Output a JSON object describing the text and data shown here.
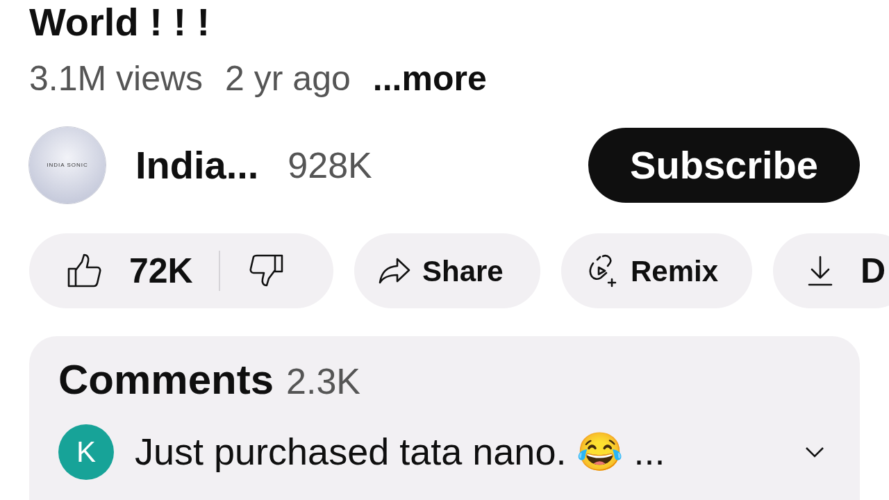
{
  "title": "World ! ! !",
  "meta": {
    "views": "3.1M views",
    "age": "2 yr ago",
    "more": "...more"
  },
  "channel": {
    "name": "India...",
    "avatar_text": "INDIA SONIC",
    "subscribers": "928K",
    "subscribe": "Subscribe"
  },
  "actions": [
    {
      "kind": "like",
      "label": "72K"
    },
    {
      "kind": "share",
      "label": "Share"
    },
    {
      "kind": "remix",
      "label": "Remix"
    },
    {
      "kind": "download",
      "label": "D"
    }
  ],
  "comments": {
    "title": "Comments",
    "count": "2.3K",
    "top": {
      "avatar": "K",
      "text": "Just purchased tata nano. 😂 ..."
    }
  }
}
